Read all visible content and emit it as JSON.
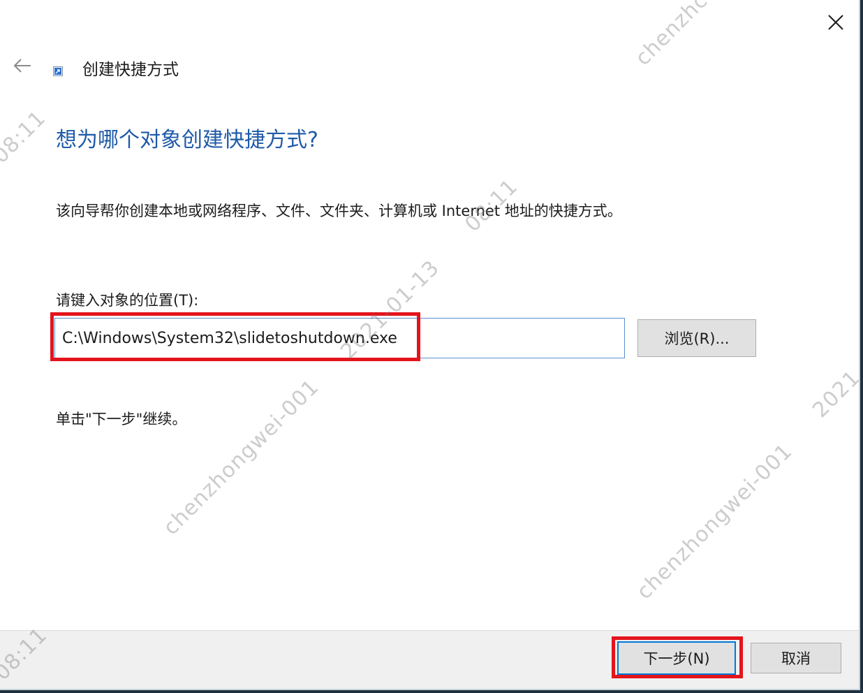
{
  "window": {
    "title": "创建快捷方式"
  },
  "page": {
    "heading": "想为哪个对象创建快捷方式?",
    "description": "该向导帮你创建本地或网络程序、文件、文件夹、计算机或 Internet 地址的快捷方式。",
    "location_label": "请键入对象的位置(T):",
    "location_value": "C:\\Windows\\System32\\slidetoshutdown.exe",
    "browse_label": "浏览(R)...",
    "continue_hint": "单击\"下一步\"继续。"
  },
  "footer": {
    "next_label": "下一步(N)",
    "cancel_label": "取消"
  },
  "watermarks": [
    "chenzhc",
    "08:11",
    "08:11",
    "2021-01-13",
    "chenzhongwei-001",
    "chenzhongwei-001",
    "2021",
    "08:11"
  ],
  "colors": {
    "heading": "#1e5aa8",
    "highlight": "#e4141c",
    "input_border": "#5a8fd0",
    "focus_border": "#0078d7",
    "footer_bg": "#f0f0f0"
  },
  "icons": {
    "close": "close-icon",
    "back": "back-arrow-icon",
    "app": "shortcut-icon"
  }
}
